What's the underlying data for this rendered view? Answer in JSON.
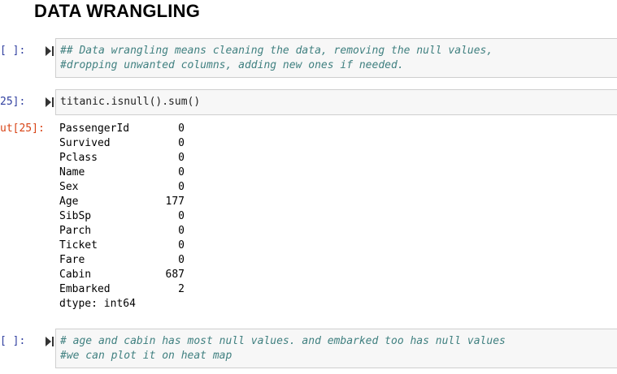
{
  "heading": "DATA WRANGLING",
  "cells": [
    {
      "prompt": "[ ]:",
      "lines": [
        "## Data wrangling means cleaning the data, removing the null values,",
        "#dropping unwanted columns, adding new ones if needed."
      ]
    },
    {
      "prompt": "25]:",
      "lines": [
        "titanic.isnull().sum()"
      ]
    },
    {
      "prompt": "[ ]:",
      "lines": [
        "# age and cabin has most null values. and embarked too has null values",
        "#we can plot it on heat map"
      ]
    }
  ],
  "output": {
    "prompt": "ut[25]:",
    "rows": [
      {
        "key": "PassengerId",
        "value": "0"
      },
      {
        "key": "Survived",
        "value": "0"
      },
      {
        "key": "Pclass",
        "value": "0"
      },
      {
        "key": "Name",
        "value": "0"
      },
      {
        "key": "Sex",
        "value": "0"
      },
      {
        "key": "Age",
        "value": "177"
      },
      {
        "key": "SibSp",
        "value": "0"
      },
      {
        "key": "Parch",
        "value": "0"
      },
      {
        "key": "Ticket",
        "value": "0"
      },
      {
        "key": "Fare",
        "value": "0"
      },
      {
        "key": "Cabin",
        "value": "687"
      },
      {
        "key": "Embarked",
        "value": "2"
      }
    ],
    "dtype": "dtype: int64"
  },
  "colors": {
    "prompt_in": "#303f9f",
    "prompt_out": "#d84315",
    "comment": "#408080",
    "cell_bg": "#f7f7f7"
  },
  "icons": {
    "run": "step-run-icon"
  }
}
